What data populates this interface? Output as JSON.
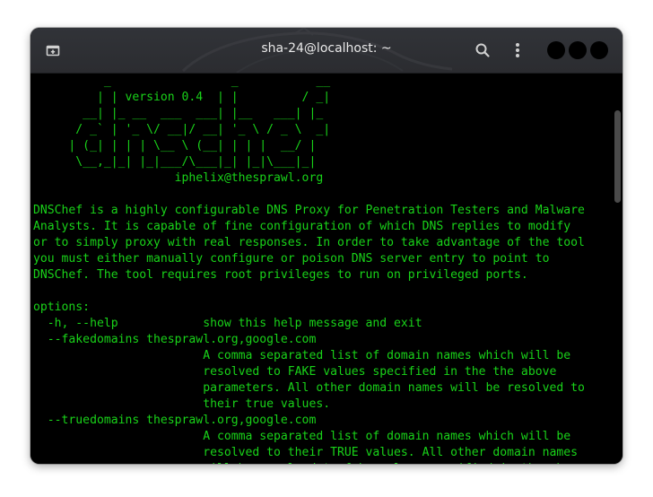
{
  "window": {
    "title": "sha-24@localhost: ~"
  },
  "icons": {
    "new_tab": "new-tab-icon",
    "search": "search-icon",
    "menu": "vertical-dots-icon"
  },
  "colors": {
    "terminal_text": "#19d319",
    "terminal_bg": "#000000",
    "titlebar_bg": "#2f3034"
  },
  "terminal": {
    "lines": [
      "          _                 _           __",
      "         | | version 0.4  | |         / _|",
      "       __| |_ __  ___  ___| |__   ___| |_",
      "      / _` | '_ \\/ __|/ __| '_ \\ / _ \\  _|",
      "     | (_| | | | \\__ \\ (__| | | |  __/ |",
      "      \\__,_|_| |_|___/\\___|_| |_|\\___|_|",
      "                    iphelix@thesprawl.org",
      "",
      "DNSChef is a highly configurable DNS Proxy for Penetration Testers and Malware",
      "Analysts. It is capable of fine configuration of which DNS replies to modify",
      "or to simply proxy with real responses. In order to take advantage of the tool",
      "you must either manually configure or poison DNS server entry to point to",
      "DNSChef. The tool requires root privileges to run on privileged ports.",
      "",
      "options:",
      "  -h, --help            show this help message and exit",
      "  --fakedomains thesprawl.org,google.com",
      "                        A comma separated list of domain names which will be",
      "                        resolved to FAKE values specified in the the above",
      "                        parameters. All other domain names will be resolved to",
      "                        their true values.",
      "  --truedomains thesprawl.org,google.com",
      "                        A comma separated list of domain names which will be",
      "                        resolved to their TRUE values. All other domain names",
      "                        will be resolved to fake values specified in the above"
    ]
  }
}
